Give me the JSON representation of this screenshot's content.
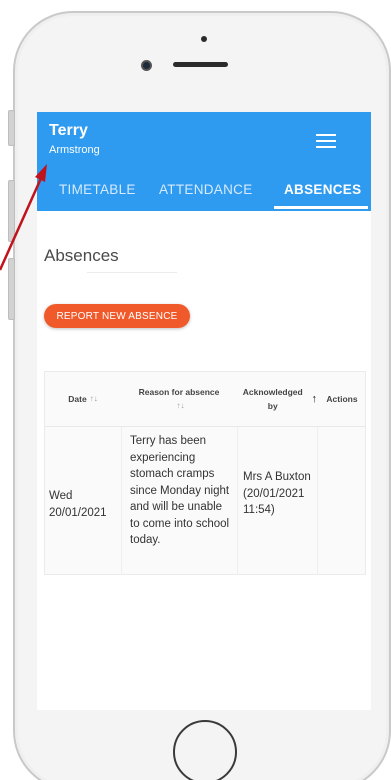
{
  "student": {
    "first_name": "Terry",
    "last_name": "Armstrong"
  },
  "tabs": [
    {
      "label": "TIMETABLE",
      "active": false
    },
    {
      "label": "ATTENDANCE",
      "active": false
    },
    {
      "label": "ABSENCES",
      "active": true
    }
  ],
  "page": {
    "title": "Absences",
    "report_button": "REPORT NEW ABSENCE"
  },
  "table": {
    "headers": {
      "date": "Date",
      "reason": "Reason for absence",
      "acknowledged": "Acknowledged by",
      "actions": "Actions"
    },
    "rows": [
      {
        "date": "Wed 20/01/2021",
        "reason": "Terry has been experiencing stomach cramps since Monday night and will be unable to come into school today.",
        "acknowledged": "Mrs A Buxton (20/01/2021 11:54)",
        "actions": ""
      }
    ]
  },
  "colors": {
    "appbar": "#2e9af0",
    "report_button": "#f05a2a",
    "annotation_arrow": "#c0131c"
  }
}
